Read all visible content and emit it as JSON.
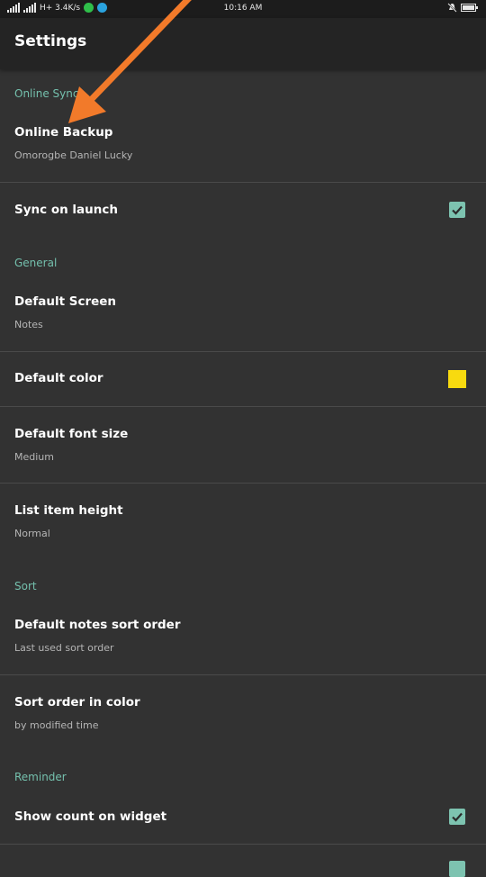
{
  "status_bar": {
    "network": "H+ 3.4K/s",
    "time": "10:16 AM"
  },
  "toolbar": {
    "title": "Settings"
  },
  "sections": {
    "online_sync": "Online Sync",
    "general": "General",
    "sort": "Sort",
    "reminder": "Reminder"
  },
  "items": {
    "online_backup": {
      "title": "Online Backup",
      "summary": "Omorogbe Daniel Lucky"
    },
    "sync_on_launch": {
      "title": "Sync on launch",
      "checked": true
    },
    "default_screen": {
      "title": "Default Screen",
      "summary": "Notes"
    },
    "default_color": {
      "title": "Default color",
      "color": "#f8da0f"
    },
    "default_font_size": {
      "title": "Default font size",
      "summary": "Medium"
    },
    "list_item_height": {
      "title": "List item height",
      "summary": "Normal"
    },
    "default_notes_sort_order": {
      "title": "Default notes sort order",
      "summary": "Last used sort order"
    },
    "sort_order_in_color": {
      "title": "Sort order in color",
      "summary": "by modified time"
    },
    "show_count_on_widget": {
      "title": "Show count on widget",
      "checked": true
    }
  },
  "colors": {
    "background": "#323232",
    "toolbar": "#242424",
    "accent": "#74c0ad",
    "checkbox": "#7dc3b0",
    "annotation_arrow": "#f27a2a"
  },
  "icons": {
    "whatsapp": "whatsapp-icon",
    "telegram": "telegram-icon",
    "mute": "mute-icon",
    "battery": "battery-icon"
  }
}
